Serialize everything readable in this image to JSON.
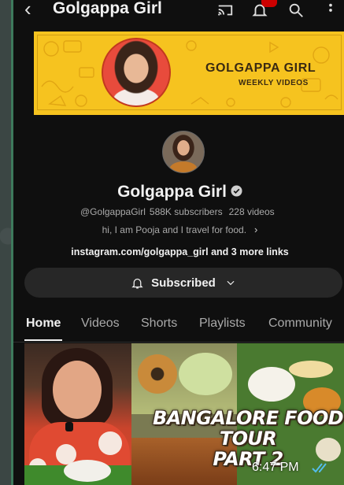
{
  "topbar": {
    "title": "Golgappa Girl",
    "icons": [
      "back-arrow-icon",
      "cast-icon",
      "bell-icon",
      "search-icon",
      "more-vertical-icon"
    ]
  },
  "banner": {
    "title": "GOLGAPPA GIRL",
    "subtitle": "WEEKLY VIDEOS",
    "accent": "#f6c31f"
  },
  "channel": {
    "name": "Golgappa Girl",
    "handle": "@GolgappaGirl",
    "subscribers": "588K subscribers",
    "videos": "228 videos",
    "description": "hi, I am Pooja and I travel for food.",
    "links": "instagram.com/golgappa_girl and 3 more links"
  },
  "subscribe": {
    "label": "Subscribed"
  },
  "tabs": [
    {
      "label": "Home",
      "active": true
    },
    {
      "label": "Videos",
      "active": false
    },
    {
      "label": "Shorts",
      "active": false
    },
    {
      "label": "Playlists",
      "active": false
    },
    {
      "label": "Community",
      "active": false
    }
  ],
  "video": {
    "thumbnail_title_line1": "BANGALORE FOOD TOUR",
    "thumbnail_title_line2": "PART 2"
  },
  "message": {
    "time": "6:47 PM"
  },
  "colors": {
    "background": "#0f0f0f",
    "button": "#272727",
    "secondary_text": "#aaaaaa",
    "notification_badge": "#cc0000",
    "read_ticks": "#53bdeb"
  }
}
